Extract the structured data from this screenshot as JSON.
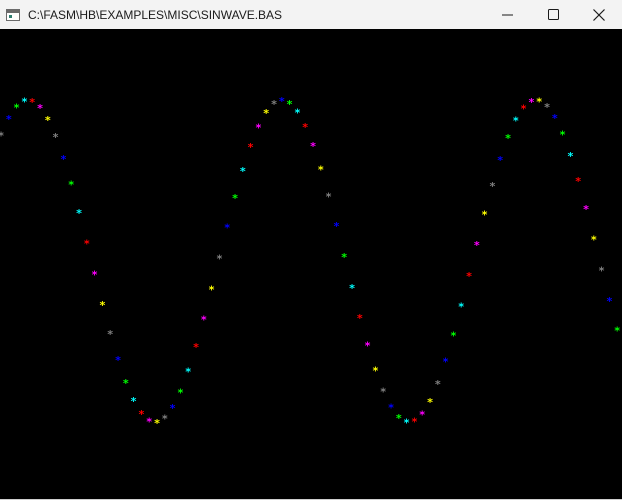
{
  "window": {
    "title": "C:\\FASM\\HB\\EXAMPLES\\MISC\\SINWAVE.BAS",
    "icon": "console-window-icon",
    "controls": [
      "minimize-icon",
      "maximize-icon",
      "close-icon"
    ]
  },
  "output": {
    "background": "#000000",
    "glyph": "*",
    "color_cycle": [
      "#808080",
      "#0000ff",
      "#00ff00",
      "#00ffff",
      "#ff0000",
      "#ff00ff",
      "#ffff00"
    ]
  }
}
